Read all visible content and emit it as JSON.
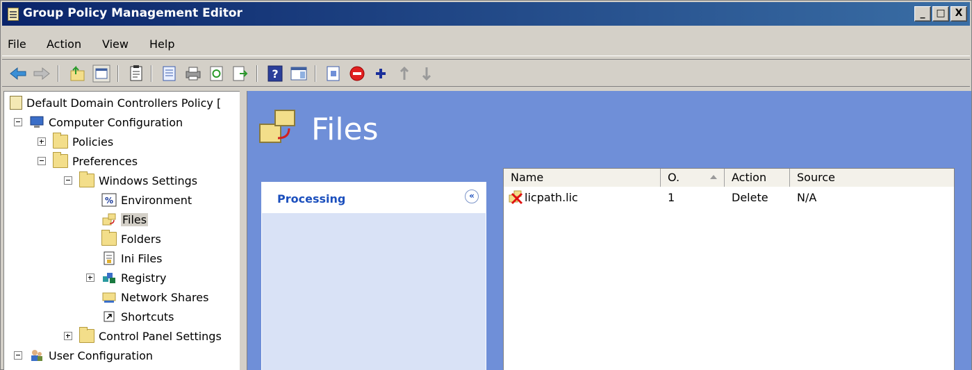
{
  "window": {
    "title": "Group Policy Management Editor",
    "buttons": {
      "minimize": "_",
      "maximize": "□",
      "close": "X"
    }
  },
  "menubar": {
    "items": [
      "File",
      "Action",
      "View",
      "Help"
    ]
  },
  "toolbar": {
    "icons": [
      "back-arrow-icon",
      "forward-arrow-icon",
      "up-folder-icon",
      "show-hide-tree-icon",
      "properties-icon",
      "export-list-icon",
      "print-icon",
      "refresh-icon",
      "export-icon",
      "help-icon",
      "show-hide-action-pane-icon",
      "new-item-icon",
      "delete-icon",
      "add-icon",
      "move-up-icon",
      "move-down-icon"
    ]
  },
  "tree": {
    "items": [
      {
        "label": "Default Domain Controllers Policy [",
        "level": 0
      },
      {
        "label": "Computer Configuration",
        "level": 0
      },
      {
        "label": "Policies",
        "level": 1
      },
      {
        "label": "Preferences",
        "level": 1
      },
      {
        "label": "Windows Settings",
        "level": 2
      },
      {
        "label": "Environment",
        "level": 3
      },
      {
        "label": "Files",
        "level": 3,
        "selected": true
      },
      {
        "label": "Folders",
        "level": 3
      },
      {
        "label": "Ini Files",
        "level": 3
      },
      {
        "label": "Registry",
        "level": 3
      },
      {
        "label": "Network Shares",
        "level": 3
      },
      {
        "label": "Shortcuts",
        "level": 3
      },
      {
        "label": "Control Panel Settings",
        "level": 2
      },
      {
        "label": "User Configuration",
        "level": 0
      }
    ]
  },
  "main": {
    "title": "Files",
    "processing": {
      "title": "Processing",
      "collapse": "«"
    },
    "list": {
      "columns": [
        "Name",
        "O.",
        "Action",
        "Source"
      ],
      "rows": [
        {
          "name": "licpath.lic",
          "order": "1",
          "action": "Delete",
          "source": "N/A"
        }
      ]
    }
  },
  "colors": {
    "titlebar": "#0a246a",
    "pane_background": "#6f8fd8",
    "processing_title": "#1b4fbd"
  }
}
